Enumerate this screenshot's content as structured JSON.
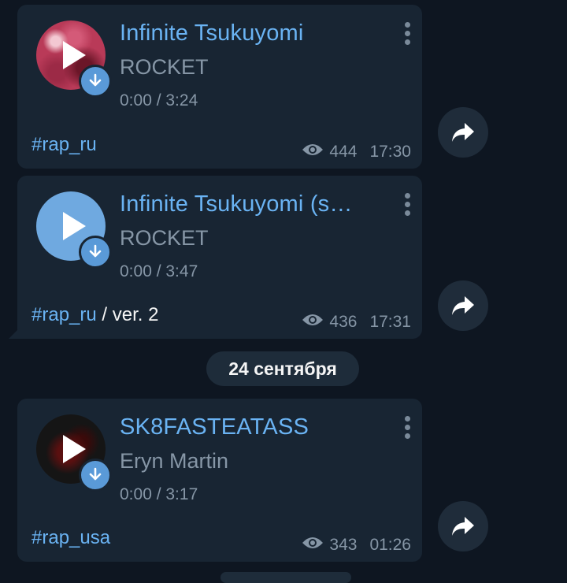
{
  "messages": [
    {
      "title": "Infinite Tsukuyomi",
      "artist": "ROCKET",
      "time": "0:00 / 3:24",
      "tag": "#rap_ru",
      "tag_extra": "",
      "views": "444",
      "clock": "17:30",
      "cover_icon": "album-art"
    },
    {
      "title": "Infinite Tsukuyomi (s…",
      "artist": "ROCKET",
      "time": "0:00 / 3:47",
      "tag": "#rap_ru",
      "tag_extra": " / ver. 2",
      "views": "436",
      "clock": "17:31",
      "cover_icon": "play-circle"
    },
    {
      "title": "SK8FASTEATASS",
      "artist": "Eryn Martin",
      "time": "0:00 / 3:17",
      "tag": "#rap_usa",
      "tag_extra": "",
      "views": "343",
      "clock": "01:26",
      "cover_icon": "album-art"
    }
  ],
  "date_separator": "24 сентября",
  "colors": {
    "background": "#0e1621",
    "bubble": "#182533",
    "accent": "#6ab3f3",
    "muted": "#8696a6"
  }
}
